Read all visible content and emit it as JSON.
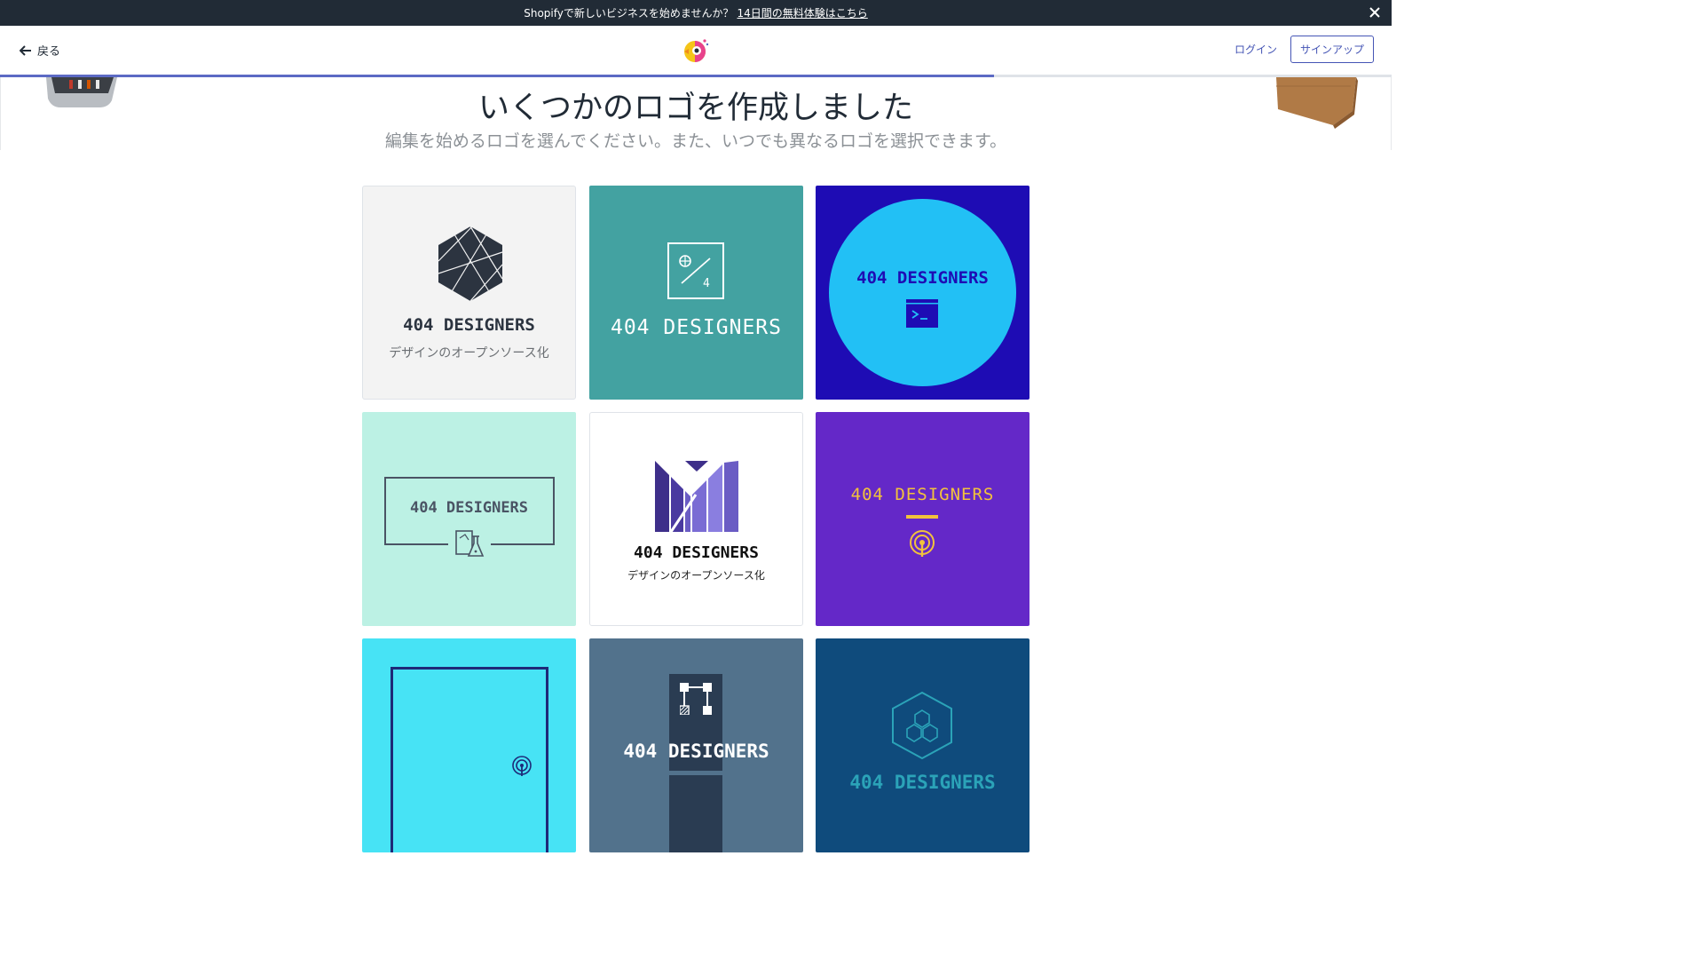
{
  "announcement": {
    "text": "Shopifyで新しいビジネスを始めませんか？",
    "link": "14日間の無料体験はこちら"
  },
  "header": {
    "back_label": "戻る",
    "login_label": "ログイン",
    "signup_label": "サインアップ"
  },
  "progress": {
    "fraction": 0.714
  },
  "page": {
    "title": "いくつかのロゴを作成しました",
    "subtitle": "編集を始めるロゴを選んでください。また、いつでも異なるロゴを選択できます。"
  },
  "logos": [
    {
      "name": "404 DESIGNERS",
      "tagline": "デザインのオープンソース化",
      "background": "#f3f3f3",
      "icon": "hexagon-facets-icon"
    },
    {
      "name": "404 DESIGNERS",
      "background": "#43a2a1",
      "icon": "globe-fraction-icon"
    },
    {
      "name": "404 DESIGNERS",
      "background": "#1e0cb4",
      "icon": "terminal-window-icon"
    },
    {
      "name": "404 DESIGNERS",
      "background": "#bcf1e4",
      "icon": "lab-flask-icon"
    },
    {
      "name": "404 DESIGNERS",
      "tagline": "デザインのオープンソース化",
      "background": "#ffffff",
      "icon": "m-bars-icon"
    },
    {
      "name": "404 DESIGNERS",
      "background": "#6428c8",
      "icon": "broadcast-icon"
    },
    {
      "name": "",
      "background": "#47e3f5",
      "icon": "broadcast-icon"
    },
    {
      "name": "404 DESIGNERS",
      "background": "#52728c",
      "icon": "network-nodes-icon"
    },
    {
      "name": "404 DESIGNERS",
      "background": "#0f4b7c",
      "icon": "cubes-hexagon-icon"
    }
  ],
  "colors": {
    "accent": "#5c6ac4",
    "link": "#4555b5",
    "topbar": "#212b36"
  }
}
